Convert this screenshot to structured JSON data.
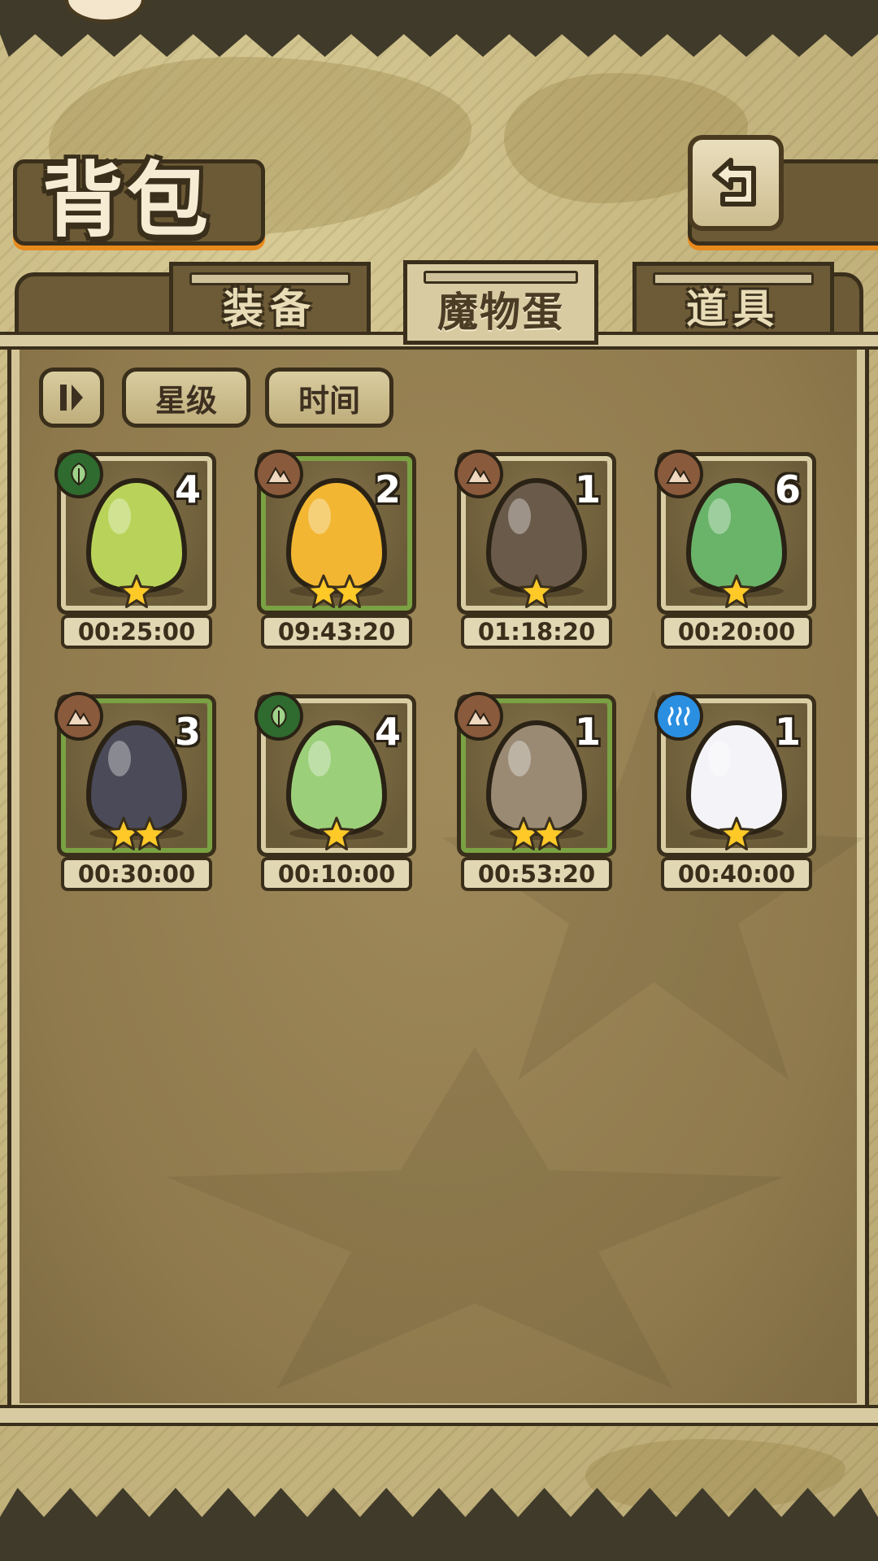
{
  "header": {
    "title": "背包"
  },
  "tabs": [
    {
      "label": "装备",
      "active": false
    },
    {
      "label": "魔物蛋",
      "active": true
    },
    {
      "label": "道具",
      "active": false
    }
  ],
  "sort": {
    "star_label": "星级",
    "time_label": "时间"
  },
  "eggs": [
    {
      "element": "nature",
      "count": "4",
      "stars": 1,
      "timer": "00:25:00",
      "frame": "tan",
      "egg_color": "#b9d35a"
    },
    {
      "element": "earth",
      "count": "2",
      "stars": 2,
      "timer": "09:43:20",
      "frame": "green",
      "egg_color": "#f2b632"
    },
    {
      "element": "earth",
      "count": "1",
      "stars": 1,
      "timer": "01:18:20",
      "frame": "tan",
      "egg_color": "#6a5a4a"
    },
    {
      "element": "earth",
      "count": "6",
      "stars": 1,
      "timer": "00:20:00",
      "frame": "tan",
      "egg_color": "#6ab46a"
    },
    {
      "element": "earth",
      "count": "3",
      "stars": 2,
      "timer": "00:30:00",
      "frame": "green",
      "egg_color": "#4a4a58"
    },
    {
      "element": "nature",
      "count": "4",
      "stars": 1,
      "timer": "00:10:00",
      "frame": "tan",
      "egg_color": "#9ccf7a"
    },
    {
      "element": "earth",
      "count": "1",
      "stars": 2,
      "timer": "00:53:20",
      "frame": "green",
      "egg_color": "#9a8a74"
    },
    {
      "element": "water",
      "count": "1",
      "stars": 1,
      "timer": "00:40:00",
      "frame": "tan",
      "egg_color": "#f4f4f8"
    }
  ],
  "colors": {
    "accent_orange": "#e98a1c",
    "frame_dark": "#3a2f1b",
    "rare_frame": "#7aa142"
  }
}
